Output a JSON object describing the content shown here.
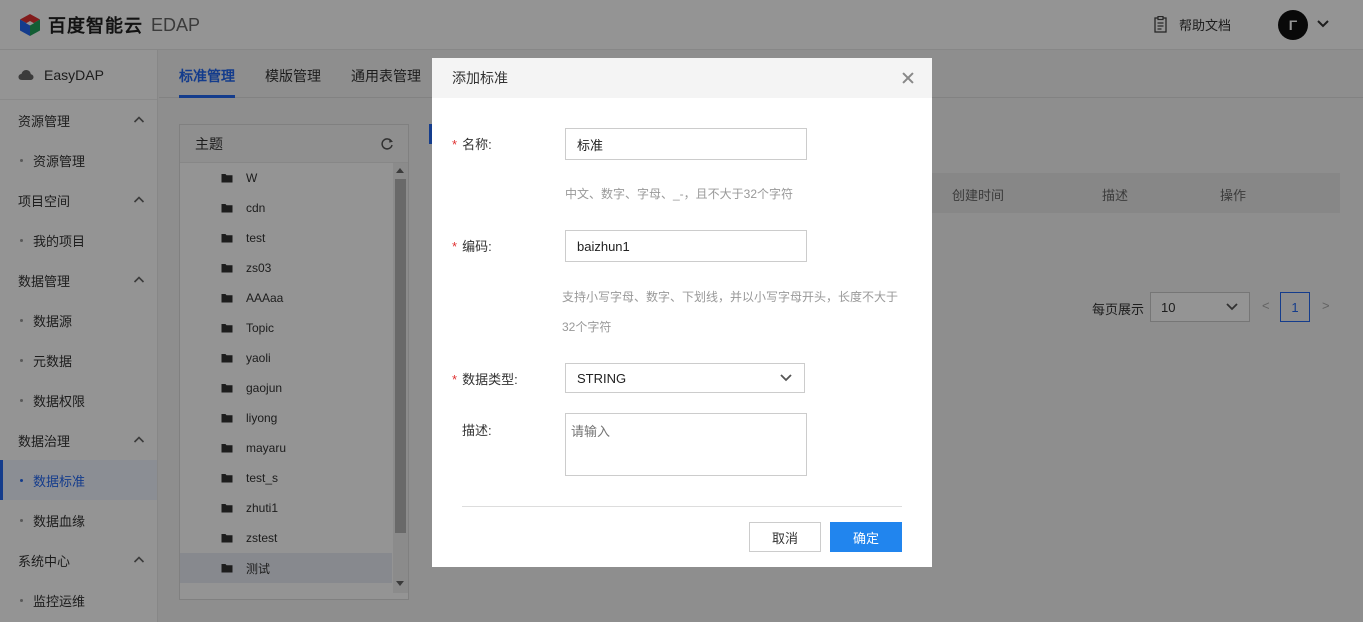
{
  "header": {
    "brand_name": "百度智能云",
    "product": "EDAP",
    "help_label": "帮助文档",
    "avatar_letter": "Γ"
  },
  "sidebar": {
    "brand": "EasyDAP",
    "groups": [
      {
        "label": "资源管理",
        "items": [
          "资源管理"
        ]
      },
      {
        "label": "项目空间",
        "items": [
          "我的项目"
        ]
      },
      {
        "label": "数据管理",
        "items": [
          "数据源",
          "元数据",
          "数据权限"
        ]
      },
      {
        "label": "数据治理",
        "items": [
          "数据标准",
          "数据血缘"
        ]
      },
      {
        "label": "系统中心",
        "items": [
          "监控运维"
        ]
      }
    ],
    "active_item": "数据标准"
  },
  "tabs": [
    "标准管理",
    "模版管理",
    "通用表管理"
  ],
  "topic_panel": {
    "title": "主题",
    "items": [
      "W",
      "cdn",
      "test",
      "zs03",
      "AAAaa",
      "Topic",
      "yaoli",
      "gaojun",
      "liyong",
      "mayaru",
      "test_s",
      "zhuti1",
      "zstest",
      "测试"
    ],
    "selected": "测试"
  },
  "table": {
    "columns": [
      "创建时间",
      "描述",
      "操作"
    ]
  },
  "pagination": {
    "per_page_label": "每页展示",
    "per_page_value": "10",
    "prev": "<",
    "current_page": "1",
    "next": ">"
  },
  "dialog": {
    "title": "添加标准",
    "name_label": "名称:",
    "name_value": "标准",
    "name_hint": "中文、数字、字母、_-，且不大于32个字符",
    "code_label": "编码:",
    "code_value": "baizhun1",
    "code_hint_line1": "支持小写字母、数字、下划线，并以小写字母开头，长度不大于",
    "code_hint_line2": "32个字符",
    "type_label": "数据类型:",
    "type_value": "STRING",
    "desc_label": "描述:",
    "desc_placeholder": "请输入",
    "cancel_label": "取消",
    "ok_label": "确定"
  },
  "colors": {
    "accent": "#2468f2",
    "primary_button": "#2185ee",
    "required": "#e03131"
  }
}
